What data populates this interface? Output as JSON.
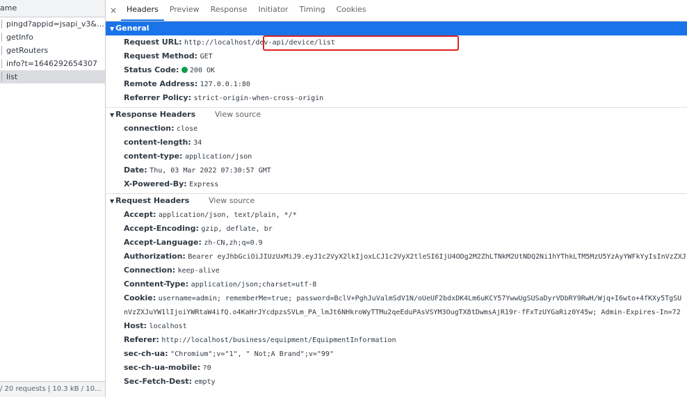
{
  "left": {
    "header": "ame",
    "requests": [
      {
        "name": "pingd?appid=jsapi_v3&lo...",
        "selected": false
      },
      {
        "name": "getInfo",
        "selected": false
      },
      {
        "name": "getRouters",
        "selected": false
      },
      {
        "name": "info?t=1646292654307",
        "selected": false
      },
      {
        "name": "list",
        "selected": true
      }
    ],
    "footer": "/ 20 requests | 10.3 kB / 10..."
  },
  "tabs": {
    "close": "×",
    "items": [
      "Headers",
      "Preview",
      "Response",
      "Initiator",
      "Timing",
      "Cookies"
    ],
    "active": "Headers"
  },
  "general": {
    "title": "General",
    "rows": [
      {
        "key": "Request URL:",
        "value": "http://localhost/dev-api/device/list"
      },
      {
        "key": "Request Method:",
        "value": "GET"
      },
      {
        "key": "Status Code:",
        "value": "200 OK"
      },
      {
        "key": "Remote Address:",
        "value": "127.0.0.1:80"
      },
      {
        "key": "Referrer Policy:",
        "value": "strict-origin-when-cross-origin"
      }
    ]
  },
  "response_headers": {
    "title": "Response Headers",
    "view_source": "View source",
    "rows": [
      {
        "key": "connection:",
        "value": "close"
      },
      {
        "key": "content-length:",
        "value": "34"
      },
      {
        "key": "content-type:",
        "value": "application/json"
      },
      {
        "key": "Date:",
        "value": "Thu, 03 Mar 2022 07:30:57 GMT"
      },
      {
        "key": "X-Powered-By:",
        "value": "Express"
      }
    ]
  },
  "request_headers": {
    "title": "Request Headers",
    "view_source": "View source",
    "rows": [
      {
        "key": "Accept:",
        "value": "application/json, text/plain, */*"
      },
      {
        "key": "Accept-Encoding:",
        "value": "gzip, deflate, br"
      },
      {
        "key": "Accept-Language:",
        "value": "zh-CN,zh;q=0.9"
      },
      {
        "key": "Authorization:",
        "value": "Bearer eyJhbGciOiJIUzUxMiJ9.eyJ1c2VyX2lkIjoxLCJ1c2VyX2tleSI6IjU4ODg2M2ZhLTNkM2UtNDQ2Ni1hYThkLTM5MzU5YzAyYWFkYyIsInVzZXJ"
      },
      {
        "key": "Connection:",
        "value": "keep-alive"
      },
      {
        "key": "Conntent-Type:",
        "value": "application/json;charset=utf-8"
      },
      {
        "key": "Cookie:",
        "value": "username=admin; rememberMe=true; password=BclV+PghJuValmSdV1N/oUeUF2bdxDK4Lm6uKCY57YwwUgSUSaDyrVDbRY9RwH/Wjq+I6wto+4fKXy5TgSU"
      },
      {
        "key": "",
        "value": "nVzZXJuYW1lIjoiYWRtaW4ifQ.o4KaHrJYcdpzsSVLm_PA_lmJt6NHkroWyTTMu2qeEduPAsVSYM3OugTX8tDwmsAjR19r-fFxTzUYGaRiz0Y45w; Admin-Expires-In=72"
      },
      {
        "key": "Host:",
        "value": "localhost"
      },
      {
        "key": "Referer:",
        "value": "http://localhost/business/equipment/EquipmentInformation"
      },
      {
        "key": "sec-ch-ua:",
        "value": "\"Chromium\";v=\"1\", \" Not;A Brand\";v=\"99\""
      },
      {
        "key": "sec-ch-ua-mobile:",
        "value": "?0"
      },
      {
        "key": "Sec-Fetch-Dest:",
        "value": "empty"
      }
    ]
  },
  "colors": {
    "accent": "#1a73e8",
    "status_ok": "#0a9e45",
    "highlight": "#e02020"
  }
}
